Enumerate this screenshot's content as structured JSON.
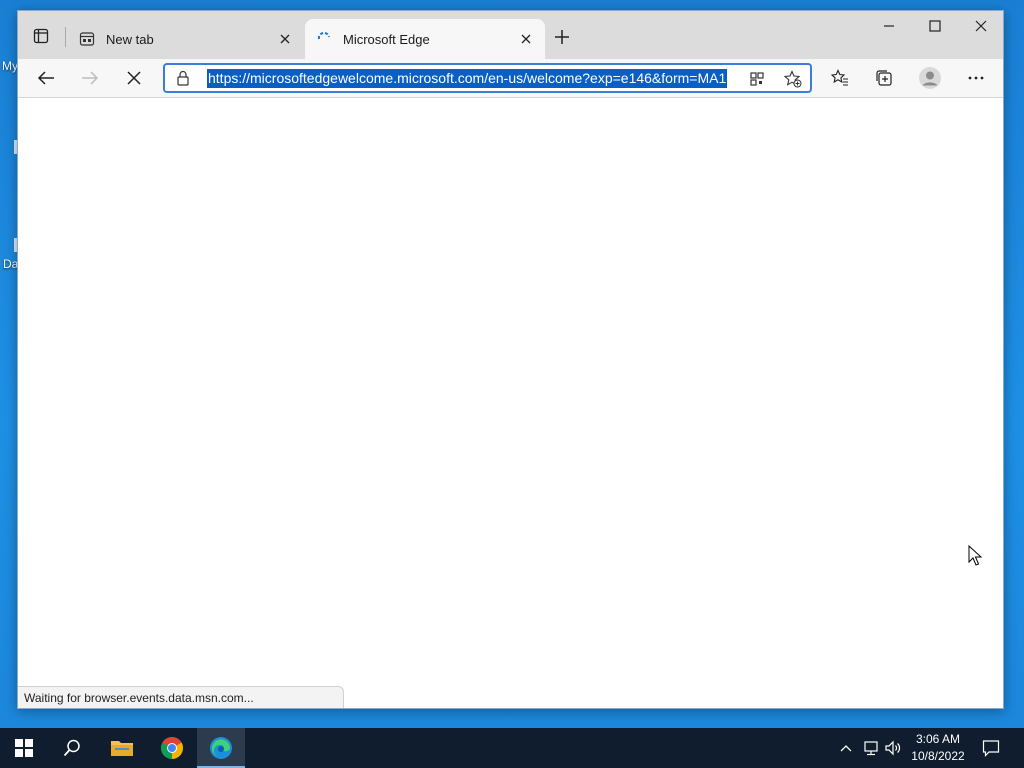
{
  "desktop": {
    "icon_labels": [
      "My",
      "Da"
    ]
  },
  "browser": {
    "tabs": [
      {
        "title": "New tab",
        "favicon": "newtab-icon",
        "active": false
      },
      {
        "title": "Microsoft Edge",
        "favicon": "loading-spinner-icon",
        "active": true
      }
    ],
    "address_bar": {
      "url": "https://microsoftedgewelcome.microsoft.com/en-us/welcome?exp=e146&form=MA1"
    },
    "status_text": "Waiting for browser.events.data.msn.com...",
    "toolbar_icons": [
      "back-arrow-icon",
      "forward-arrow-icon",
      "stop-icon",
      "favorites-icon",
      "collections-icon",
      "profile-icon",
      "more-icon"
    ]
  },
  "taskbar": {
    "apps": [
      "windows-start-icon",
      "search-icon",
      "file-explorer-icon",
      "chrome-icon",
      "edge-icon"
    ],
    "clock": {
      "time": "3:06 AM",
      "date": "10/8/2022"
    }
  },
  "colors": {
    "accent": "#0a5fc4",
    "desktop_bg": "#1e90e4",
    "taskbar_bg": "#0f1d2e"
  }
}
